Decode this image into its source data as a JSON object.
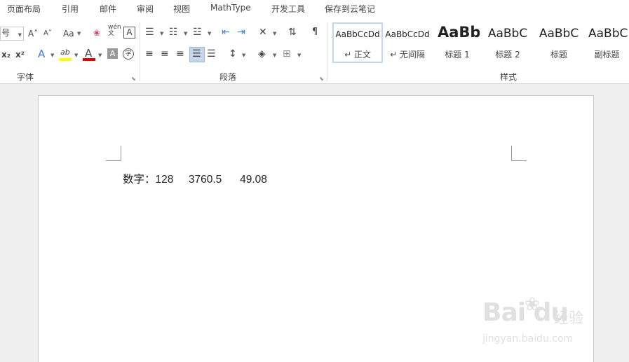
{
  "tabs": [
    "页面布局",
    "引用",
    "邮件",
    "审阅",
    "视图",
    "MathType",
    "开发工具",
    "保存到云笔记"
  ],
  "font_group": {
    "label": "字体",
    "size_box": "号",
    "grow": "A˄",
    "shrink": "A˅",
    "change_case": "Aa",
    "clear_format": "❀",
    "phonetic": "wén\n文",
    "char_border": "A",
    "subscript": "x₂",
    "superscript": "x²",
    "text_effect": "A",
    "highlight": "ab",
    "font_color": "A",
    "char_shading": "A",
    "enclose": "字"
  },
  "paragraph_group": {
    "label": "段落"
  },
  "styles_group": {
    "label": "样式",
    "items": [
      {
        "preview": "AaBbCcDd",
        "name": "↵ 正文"
      },
      {
        "preview": "AaBbCcDd",
        "name": "↵ 无间隔"
      },
      {
        "preview": "AaBb",
        "name": "标题 1"
      },
      {
        "preview": "AaBbC",
        "name": "标题 2"
      },
      {
        "preview": "AaBbC",
        "name": "标题"
      },
      {
        "preview": "AaBbC",
        "name": "副标题"
      }
    ]
  },
  "document": {
    "text": "数字：128     3760.5      49.08"
  },
  "watermark": {
    "logo": "Bai du",
    "cn": "经验",
    "url": "jingyan.baidu.com"
  },
  "colors": {
    "highlight": "#ffff00",
    "font_color": "#e00000",
    "selected": "#c5d6ea"
  }
}
